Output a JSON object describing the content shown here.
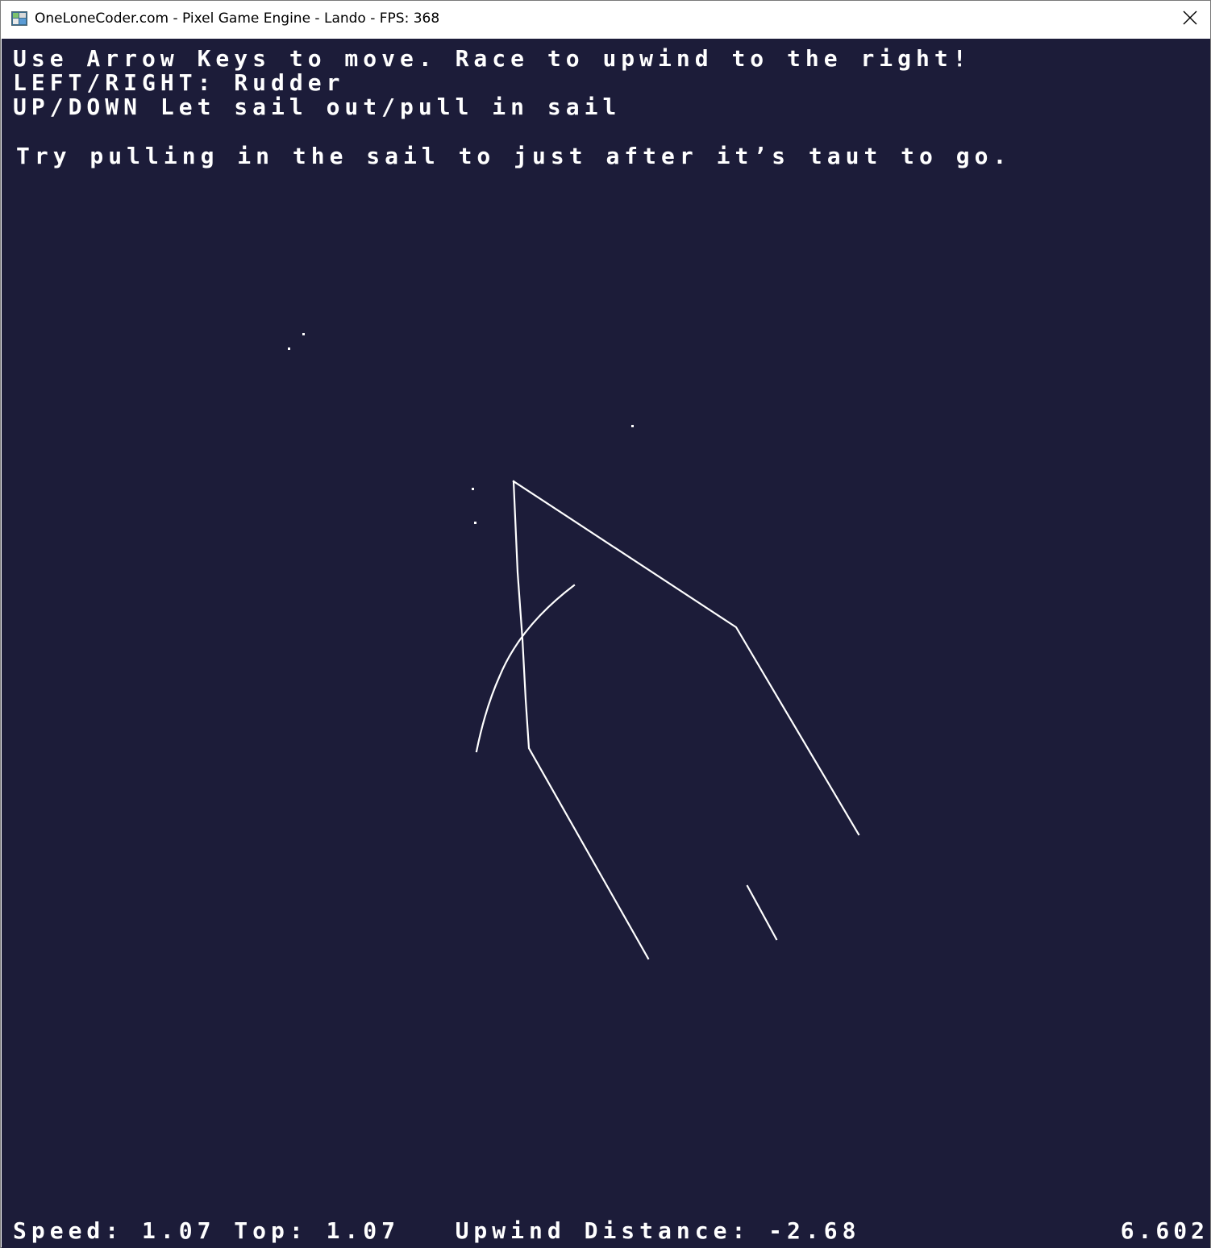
{
  "window": {
    "title": "OneLoneCoder.com - Pixel Game Engine - Lando - FPS: 368",
    "icon": "app-icon",
    "close_icon": "close-icon"
  },
  "game": {
    "background": "#1c1c39",
    "foreground": "#ffffff",
    "instructions": [
      "Use Arrow Keys to move. Race to upwind to the right!",
      "LEFT/RIGHT: Rudder",
      "UP/DOWN Let sail out/pull in sail",
      "Try pulling in the sail to just after it’s taut to go."
    ],
    "hud": {
      "stats": "Speed: 1.07 Top: 1.07   Upwind Distance: -2.68",
      "time": "6.602"
    }
  }
}
